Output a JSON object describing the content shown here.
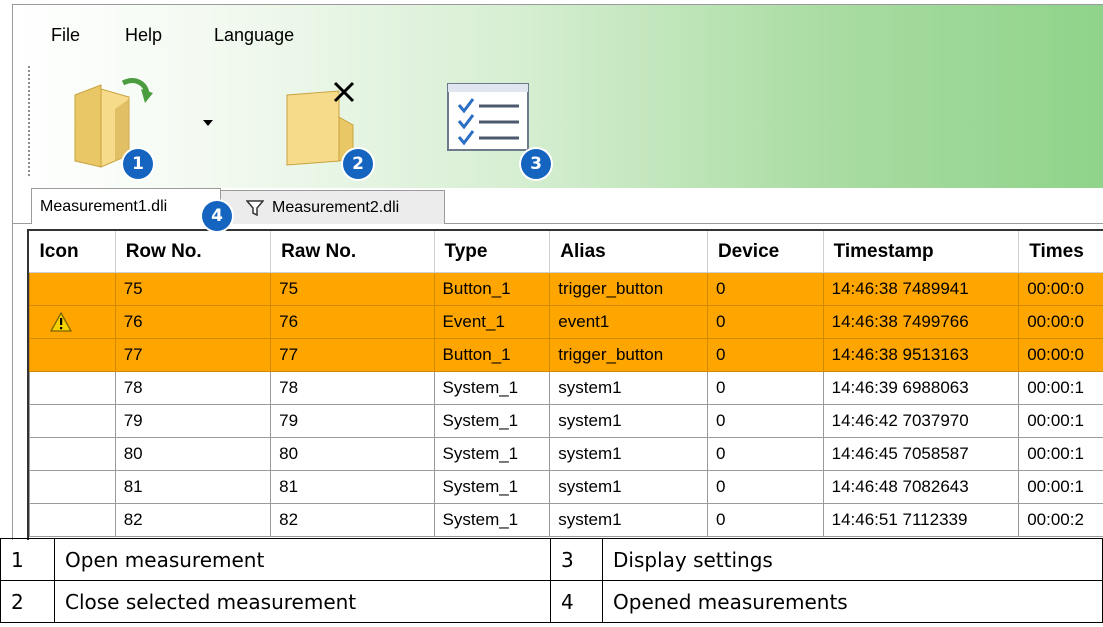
{
  "menu": [
    "File",
    "Help",
    "Language"
  ],
  "toolbar": {
    "open_icon": "folder-open-icon",
    "dropdown_icon": "dropdown-arrow-icon",
    "close_icon": "folder-close-icon",
    "settings_icon": "checklist-settings-icon",
    "badges": [
      "1",
      "2",
      "3",
      "4"
    ]
  },
  "tabs": [
    {
      "label": "Measurement1.dli",
      "active": true
    },
    {
      "label": "Measurement2.dli",
      "active": false,
      "icon": "filter-icon"
    }
  ],
  "table": {
    "columns": [
      "Icon",
      "Row No.",
      "Raw No.",
      "Type",
      "Alias",
      "Device",
      "Timestamp",
      "Times"
    ],
    "rows": [
      {
        "icon": "",
        "row": "75",
        "raw": "75",
        "type": "Button_1",
        "alias": "trigger_button",
        "device": "0",
        "timestamp": "14:46:38 7489941",
        "times": "00:00:0",
        "highlight": true
      },
      {
        "icon": "warning-icon",
        "row": "76",
        "raw": "76",
        "type": "Event_1",
        "alias": "event1",
        "device": "0",
        "timestamp": "14:46:38 7499766",
        "times": "00:00:0",
        "highlight": true
      },
      {
        "icon": "",
        "row": "77",
        "raw": "77",
        "type": "Button_1",
        "alias": "trigger_button",
        "device": "0",
        "timestamp": "14:46:38 9513163",
        "times": "00:00:0",
        "highlight": true
      },
      {
        "icon": "",
        "row": "78",
        "raw": "78",
        "type": "System_1",
        "alias": "system1",
        "device": "0",
        "timestamp": "14:46:39 6988063",
        "times": "00:00:1",
        "highlight": false
      },
      {
        "icon": "",
        "row": "79",
        "raw": "79",
        "type": "System_1",
        "alias": "system1",
        "device": "0",
        "timestamp": "14:46:42 7037970",
        "times": "00:00:1",
        "highlight": false
      },
      {
        "icon": "",
        "row": "80",
        "raw": "80",
        "type": "System_1",
        "alias": "system1",
        "device": "0",
        "timestamp": "14:46:45 7058587",
        "times": "00:00:1",
        "highlight": false
      },
      {
        "icon": "",
        "row": "81",
        "raw": "81",
        "type": "System_1",
        "alias": "system1",
        "device": "0",
        "timestamp": "14:46:48 7082643",
        "times": "00:00:1",
        "highlight": false
      },
      {
        "icon": "",
        "row": "82",
        "raw": "82",
        "type": "System_1",
        "alias": "system1",
        "device": "0",
        "timestamp": "14:46:51 7112339",
        "times": "00:00:2",
        "highlight": false
      }
    ]
  },
  "legend": [
    {
      "num": "1",
      "text": "Open measurement",
      "num2": "3",
      "text2": "Display settings"
    },
    {
      "num": "2",
      "text": "Close selected measurement",
      "num2": "4",
      "text2": "Opened measurements"
    }
  ],
  "colors": {
    "highlight": "#ffa500",
    "badge": "#1565c0",
    "band_green": "#8fd38a"
  }
}
